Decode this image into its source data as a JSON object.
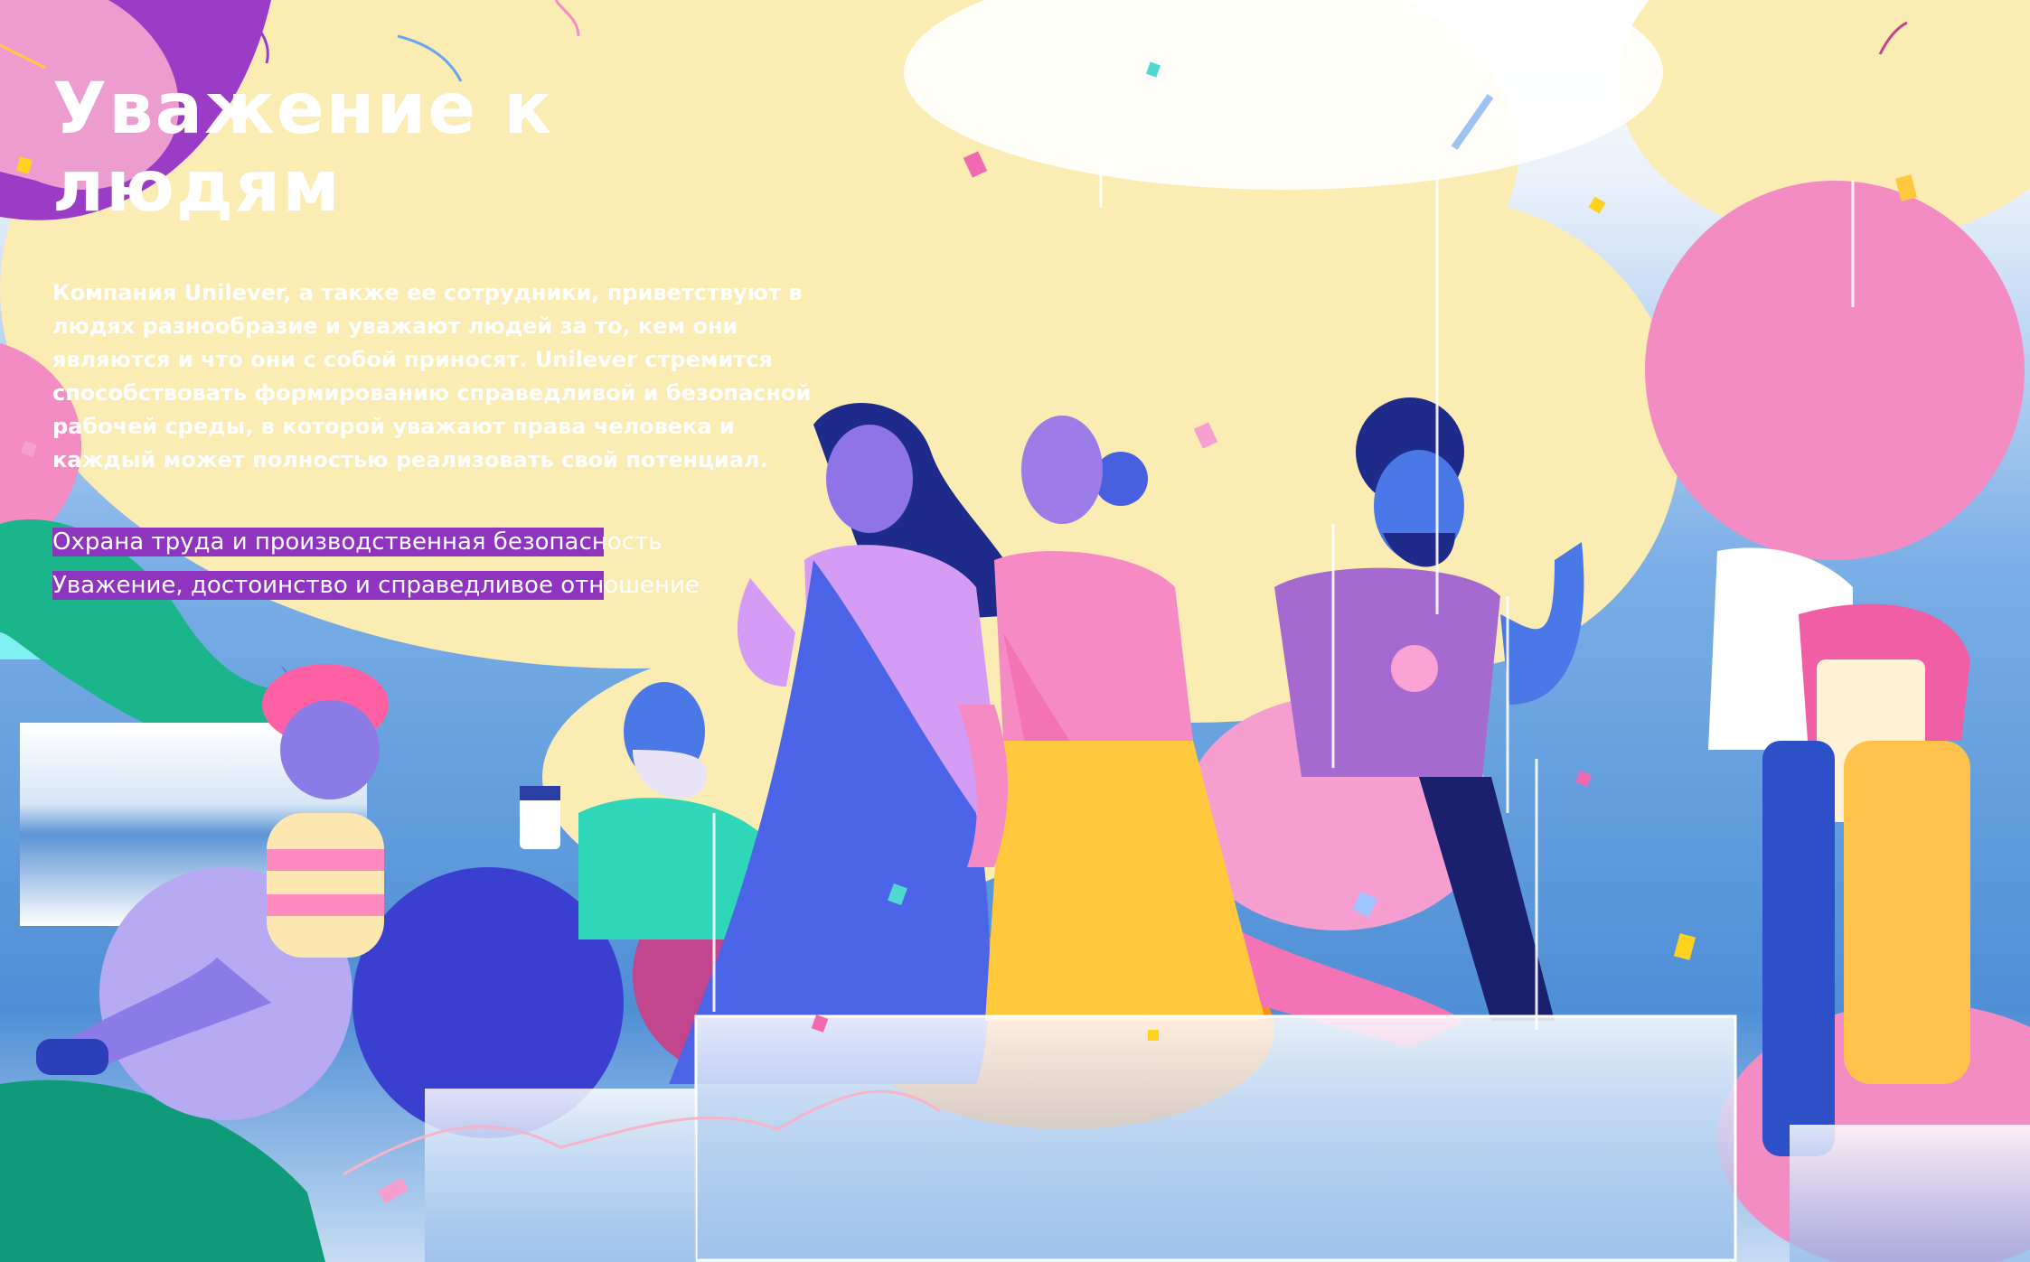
{
  "page": {
    "title": "Уважение к людям",
    "intro": "Компания Unilever, а также ее сотрудники, приветствуют в людях разнообразие и уважают людей за то, кем они являются и что они с собой приносят. Unilever стремится способствовать формированию справедливой и безопасной рабочей среды, в которой уважают права человека и каждый может полностью реализовать свой потенциал.",
    "links": [
      {
        "label": "Охрана труда и производственная безопасность"
      },
      {
        "label": "Уважение, достоинство и справедливое отношение"
      }
    ]
  },
  "colors": {
    "link_highlight": "#8e34bf",
    "accent_purple": "#9b3cc7",
    "accent_pink": "#f48cc4",
    "sky_blue": "#4f8fd6",
    "cream": "#fbecb4"
  },
  "illustration": {
    "subject": "diverse people celebrating together with confetti"
  }
}
